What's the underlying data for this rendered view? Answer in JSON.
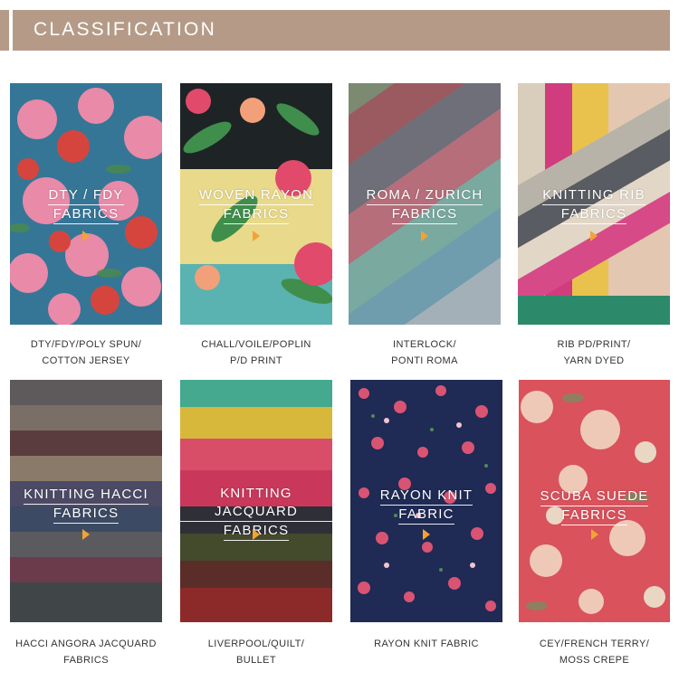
{
  "header": {
    "title": "CLASSIFICATION"
  },
  "tiles": [
    {
      "label1": "DTY / FDY",
      "label2": "FABRICS",
      "caption1": "DTY/FDY/POLY SPUN/",
      "caption2": "COTTON JERSEY"
    },
    {
      "label1": "WOVEN RAYON",
      "label2": "FABRICS",
      "caption1": "CHALL/VOILE/POPLIN",
      "caption2": "P/D PRINT"
    },
    {
      "label1": "ROMA / ZURICH",
      "label2": "FABRICS",
      "caption1": "INTERLOCK/",
      "caption2": "PONTI ROMA"
    },
    {
      "label1": "KNITTING RIB",
      "label2": "FABRICS",
      "caption1": "RIB PD/PRINT/",
      "caption2": "YARN DYED"
    },
    {
      "label1": "KNITTING HACCI",
      "label2": "FABRICS",
      "caption1": "HACCI ANGORA JACQUARD",
      "caption2": "FABRICS"
    },
    {
      "label1": "KNITTING JACQUARD",
      "label2": "FABRICS",
      "caption1": "LIVERPOOL/QUILT/",
      "caption2": "BULLET"
    },
    {
      "label1": "RAYON KNIT",
      "label2": "FABRIC",
      "caption1": "RAYON KNIT FABRIC",
      "caption2": ""
    },
    {
      "label1": "SCUBA SUEDE",
      "label2": "FABRICS",
      "caption1": "CEY/FRENCH TERRY/",
      "caption2": "MOSS CREPE"
    }
  ],
  "colors": {
    "header_bg": "#b59b87",
    "arrow": "#f2a334"
  }
}
